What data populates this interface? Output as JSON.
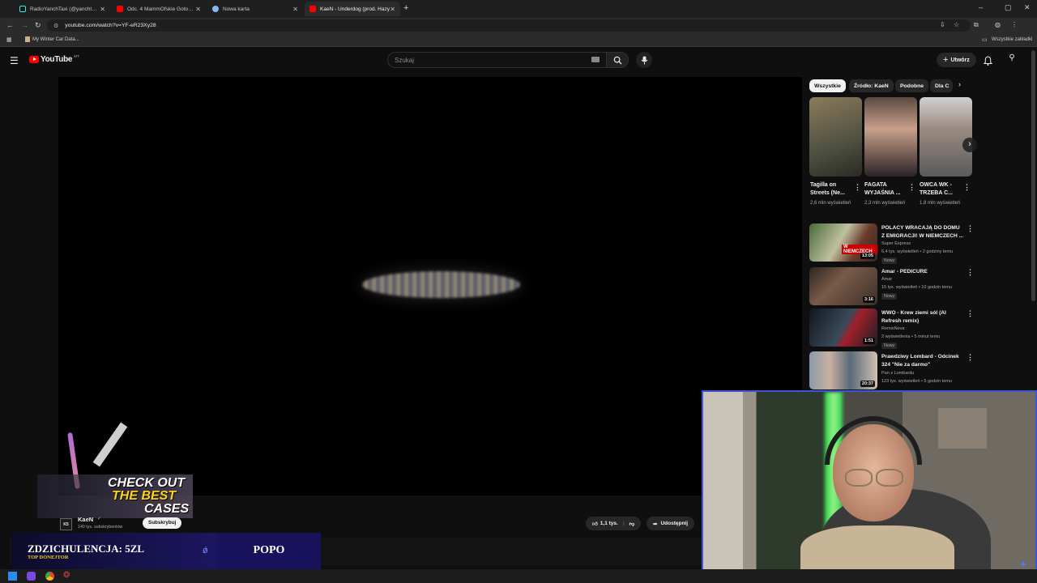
{
  "browser": {
    "tabs": [
      {
        "label": "RadioYanchTaxi (@yanchtaxi) |",
        "color": "#25f4ee",
        "active": false
      },
      {
        "label": "Odc. 4 MammOfskie Gotowan",
        "color": "#ff0000",
        "active": false
      },
      {
        "label": "Nowa karta",
        "color": "#8ab4f8",
        "active": false
      },
      {
        "label": "KaeN - Underdog (prod. Hazy",
        "color": "#ff0000",
        "active": true
      }
    ],
    "url": "youtube.com/watch?v=YF-eR23Xy28",
    "bookmark": "My Winter Car Data...",
    "all_bookmarks": "Wszystkie zakładki"
  },
  "youtube": {
    "logo": "YouTube",
    "country": "MT",
    "search_placeholder": "Szukaj",
    "create_label": "Utwórz"
  },
  "chips": [
    "Wszystkie",
    "Źródło: KaeN",
    "Podobne",
    "Dla C"
  ],
  "shorts": [
    {
      "title": "Tagilla on Streets (Ne...",
      "views": "2,6 mln wyświetleń",
      "color": "#7a6a4e"
    },
    {
      "title": "FAGATA WYJAŚNIA ...",
      "views": "2,3 mln wyświetleń",
      "color": "#9a7a6a"
    },
    {
      "title": "OWCA WK - TRZEBA C...",
      "views": "1,8 mln wyświetleń",
      "color": "#b0a090"
    }
  ],
  "related": [
    {
      "title": "POLACY WRACAJĄ DO DOMU Z EMIGRACJI! W NIEMCZECH ...",
      "channel": "Super Express",
      "meta": "6,4 tys. wyświetleń • 2 godziny temu",
      "badge": "Nowy",
      "duration": "13:05",
      "color": "#3a5a2a",
      "thumb_text": "W NIEMCZECH"
    },
    {
      "title": "Amar - PEDICURE",
      "channel": "Amar",
      "meta": "15 tys. wyświetleń • 10 godzin temu",
      "badge": "Nowy",
      "duration": "3:16",
      "color": "#5a4a3e",
      "thumb_text": ""
    },
    {
      "title": "WWO - Krew ziemi sól (AI Refresh remix)",
      "channel": "RemixNova",
      "meta": "2 wyświetlenia • 5 minut temu",
      "badge": "Nowy",
      "duration": "1:51",
      "color": "#1c2430",
      "thumb_text": ""
    },
    {
      "title": "Prawdziwy Lombard - Odcinek 324 \"Nie za darmo\"",
      "channel": "Pan z Lombardu",
      "meta": "123 tys. wyświetleń • 5 godzin temu",
      "badge": "Nowy",
      "duration": "20:37",
      "color": "#6a7a8a",
      "thumb_text": ""
    }
  ],
  "video": {
    "channel": "KaeN",
    "subscribers": "140 tys. subskrybentów",
    "subscribe_label": "Subskrybuj",
    "likes": "1,1 tys.",
    "share_label": "Udostępnij"
  },
  "overlay": {
    "case_text_1": "CHECK OUT",
    "case_text_2": "THE BEST",
    "case_text_3": "CASES",
    "donation": "ZDZICHULENCJA: 5ZL",
    "donation_sub": "TOP DONEJTOR",
    "donation_name": "POPO"
  },
  "colors": {
    "accent_red": "#ff0000",
    "webcam_border": "#3b57d9",
    "donor_bg": "#17125a"
  }
}
